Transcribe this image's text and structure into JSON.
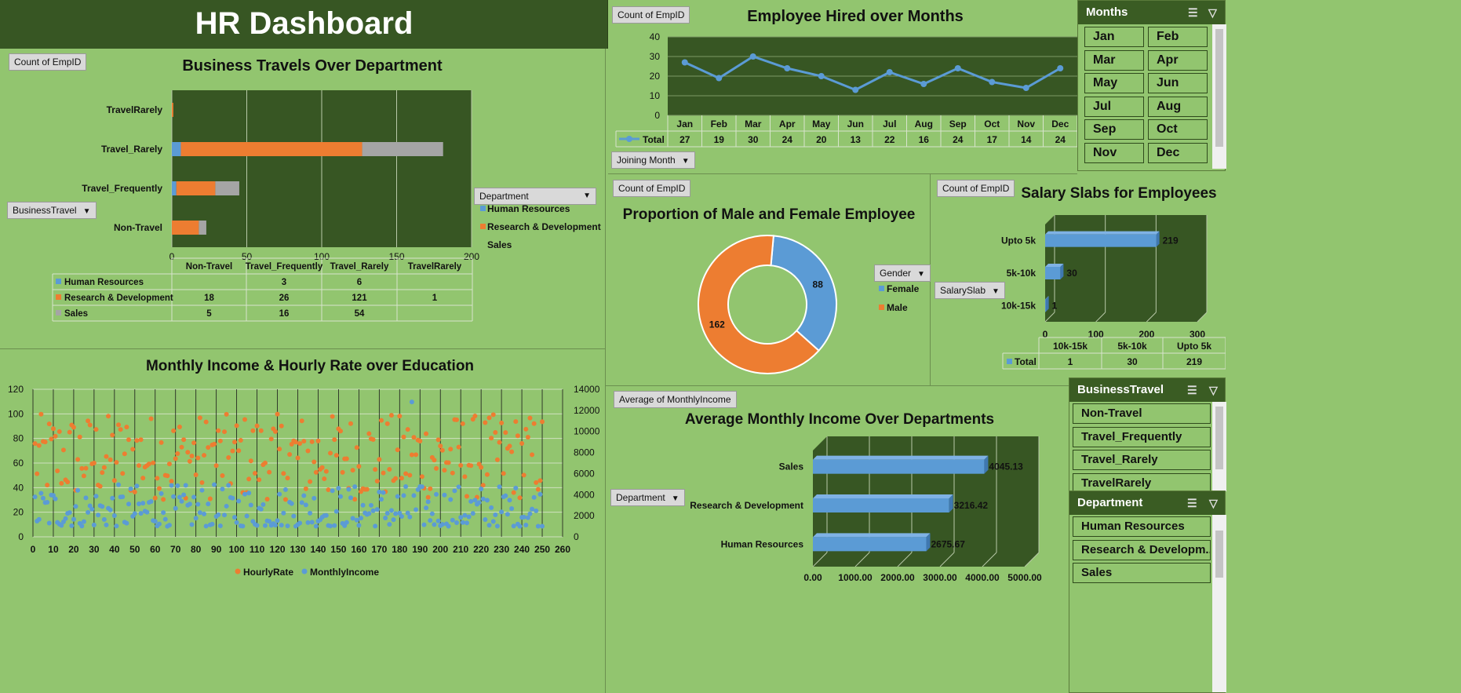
{
  "dashboard_title": "HR Dashboard",
  "colors": {
    "hr": "#5b9bd5",
    "rd": "#ed7d31",
    "sales": "#a5a5a5",
    "plot_bg": "#375623",
    "panel_bg": "#92c56f",
    "line": "#5b9bd5"
  },
  "charts": {
    "travel": {
      "field_button": "Count of EmpID",
      "axis_button": "BusinessTravel",
      "legend_button": "Department",
      "legend": [
        "Human Resources",
        "Research & Development",
        "Sales"
      ],
      "row_labels": [
        "Human Resources",
        "Research & Development",
        "Sales"
      ],
      "table_headers": [
        "Non-Travel",
        "Travel_Frequently",
        "Travel_Rarely",
        "TravelRarely"
      ]
    },
    "hired": {
      "field_button": "Count of EmpID",
      "axis_button": "Joining Month",
      "legend_label": "Total"
    },
    "gender": {
      "field_button": "Count of EmpID",
      "legend_button": "Gender"
    },
    "salary": {
      "field_button": "Count of EmpID",
      "axis_button": "SalarySlab",
      "legend_label": "Total"
    },
    "income": {
      "field_button": "Average of MonthlyIncome",
      "axis_button": "Department"
    }
  },
  "slicers": {
    "months": {
      "title": "Months",
      "items": [
        "Jan",
        "Feb",
        "Mar",
        "Apr",
        "May",
        "Jun",
        "Jul",
        "Aug",
        "Sep",
        "Oct",
        "Nov",
        "Dec"
      ]
    },
    "business_travel": {
      "title": "BusinessTravel",
      "items": [
        "Non-Travel",
        "Travel_Frequently",
        "Travel_Rarely",
        "TravelRarely"
      ]
    },
    "department": {
      "title": "Department",
      "items": [
        "Human Resources",
        "Research & Developm...",
        "Sales"
      ]
    }
  },
  "chart_data": [
    {
      "id": "travel",
      "type": "bar",
      "orientation": "horizontal",
      "stacked": true,
      "title": "Business Travels Over Department",
      "categories": [
        "TravelRarely",
        "Travel_Rarely",
        "Travel_Frequently",
        "Non-Travel"
      ],
      "series": [
        {
          "name": "Human Resources",
          "values": [
            0,
            6,
            3,
            0
          ],
          "labels": [
            "",
            "6",
            "3",
            ""
          ]
        },
        {
          "name": "Research & Development",
          "values": [
            1,
            121,
            26,
            18
          ],
          "labels": [
            "1",
            "121",
            "26",
            "18"
          ]
        },
        {
          "name": "Sales",
          "values": [
            0,
            54,
            16,
            5
          ],
          "labels": [
            "",
            "54",
            "16",
            "5"
          ]
        }
      ],
      "xlim": [
        0,
        200
      ],
      "xticks": [
        0,
        50,
        100,
        150,
        200
      ],
      "grid": true,
      "legend_position": "right"
    },
    {
      "id": "hired",
      "type": "line",
      "title": "Employee Hired over Months",
      "categories": [
        "Jan",
        "Feb",
        "Mar",
        "Apr",
        "May",
        "Jun",
        "Jul",
        "Aug",
        "Sep",
        "Oct",
        "Nov",
        "Dec"
      ],
      "series": [
        {
          "name": "Total",
          "values": [
            27,
            19,
            30,
            24,
            20,
            13,
            22,
            16,
            24,
            17,
            14,
            24
          ]
        }
      ],
      "ylim": [
        0,
        40
      ],
      "yticks": [
        0,
        10,
        20,
        30,
        40
      ],
      "grid": true
    },
    {
      "id": "gender",
      "type": "pie",
      "donut": true,
      "title": "Proportion of Male and Female Employee",
      "labels": [
        "Female",
        "Male"
      ],
      "values": [
        88,
        162
      ],
      "legend_position": "right"
    },
    {
      "id": "salary",
      "type": "bar",
      "orientation": "horizontal",
      "title": "Salary Slabs for Employees",
      "categories": [
        "Upto 5k",
        "5k-10k",
        "10k-15k"
      ],
      "series": [
        {
          "name": "Total",
          "values": [
            219,
            30,
            1
          ]
        }
      ],
      "table_headers": [
        "10k-15k",
        "5k-10k",
        "Upto 5k"
      ],
      "table_values": [
        "1",
        "30",
        "219"
      ],
      "xlim": [
        0,
        300
      ],
      "xticks": [
        0,
        100,
        200,
        300
      ],
      "grid": true
    },
    {
      "id": "education",
      "type": "scatter",
      "title": "Monthly Income & Hourly Rate over Education",
      "series": [
        {
          "name": "HourlyRate",
          "axis": "left",
          "note": "approx. 250 points, y range ~30-100"
        },
        {
          "name": "MonthlyIncome",
          "axis": "right",
          "note": "approx. 250 points, y range ~1000-12800"
        }
      ],
      "xlim": [
        0,
        260
      ],
      "xticks": [
        0,
        10,
        20,
        30,
        40,
        50,
        60,
        70,
        80,
        90,
        100,
        110,
        120,
        130,
        140,
        150,
        160,
        170,
        180,
        190,
        200,
        210,
        220,
        230,
        240,
        250,
        260
      ],
      "ylim_left": [
        0,
        120
      ],
      "yticks_left": [
        0,
        20,
        40,
        60,
        80,
        100,
        120
      ],
      "ylim_right": [
        0,
        14000
      ],
      "yticks_right": [
        0,
        2000,
        4000,
        6000,
        8000,
        10000,
        12000,
        14000
      ],
      "grid": true,
      "legend_position": "bottom"
    },
    {
      "id": "income",
      "type": "bar",
      "orientation": "horizontal",
      "title": "Average Monthly Income Over Departments",
      "categories": [
        "Sales",
        "Research & Development",
        "Human Resources"
      ],
      "series": [
        {
          "name": "Average of MonthlyIncome",
          "values": [
            4045.13,
            3216.42,
            2675.67
          ],
          "labels": [
            "4045.13",
            "3216.42",
            "2675.67"
          ]
        }
      ],
      "xlim": [
        0,
        5000
      ],
      "xticks": [
        "0.00",
        "1000.00",
        "2000.00",
        "3000.00",
        "4000.00",
        "5000.00"
      ],
      "grid": true
    }
  ]
}
